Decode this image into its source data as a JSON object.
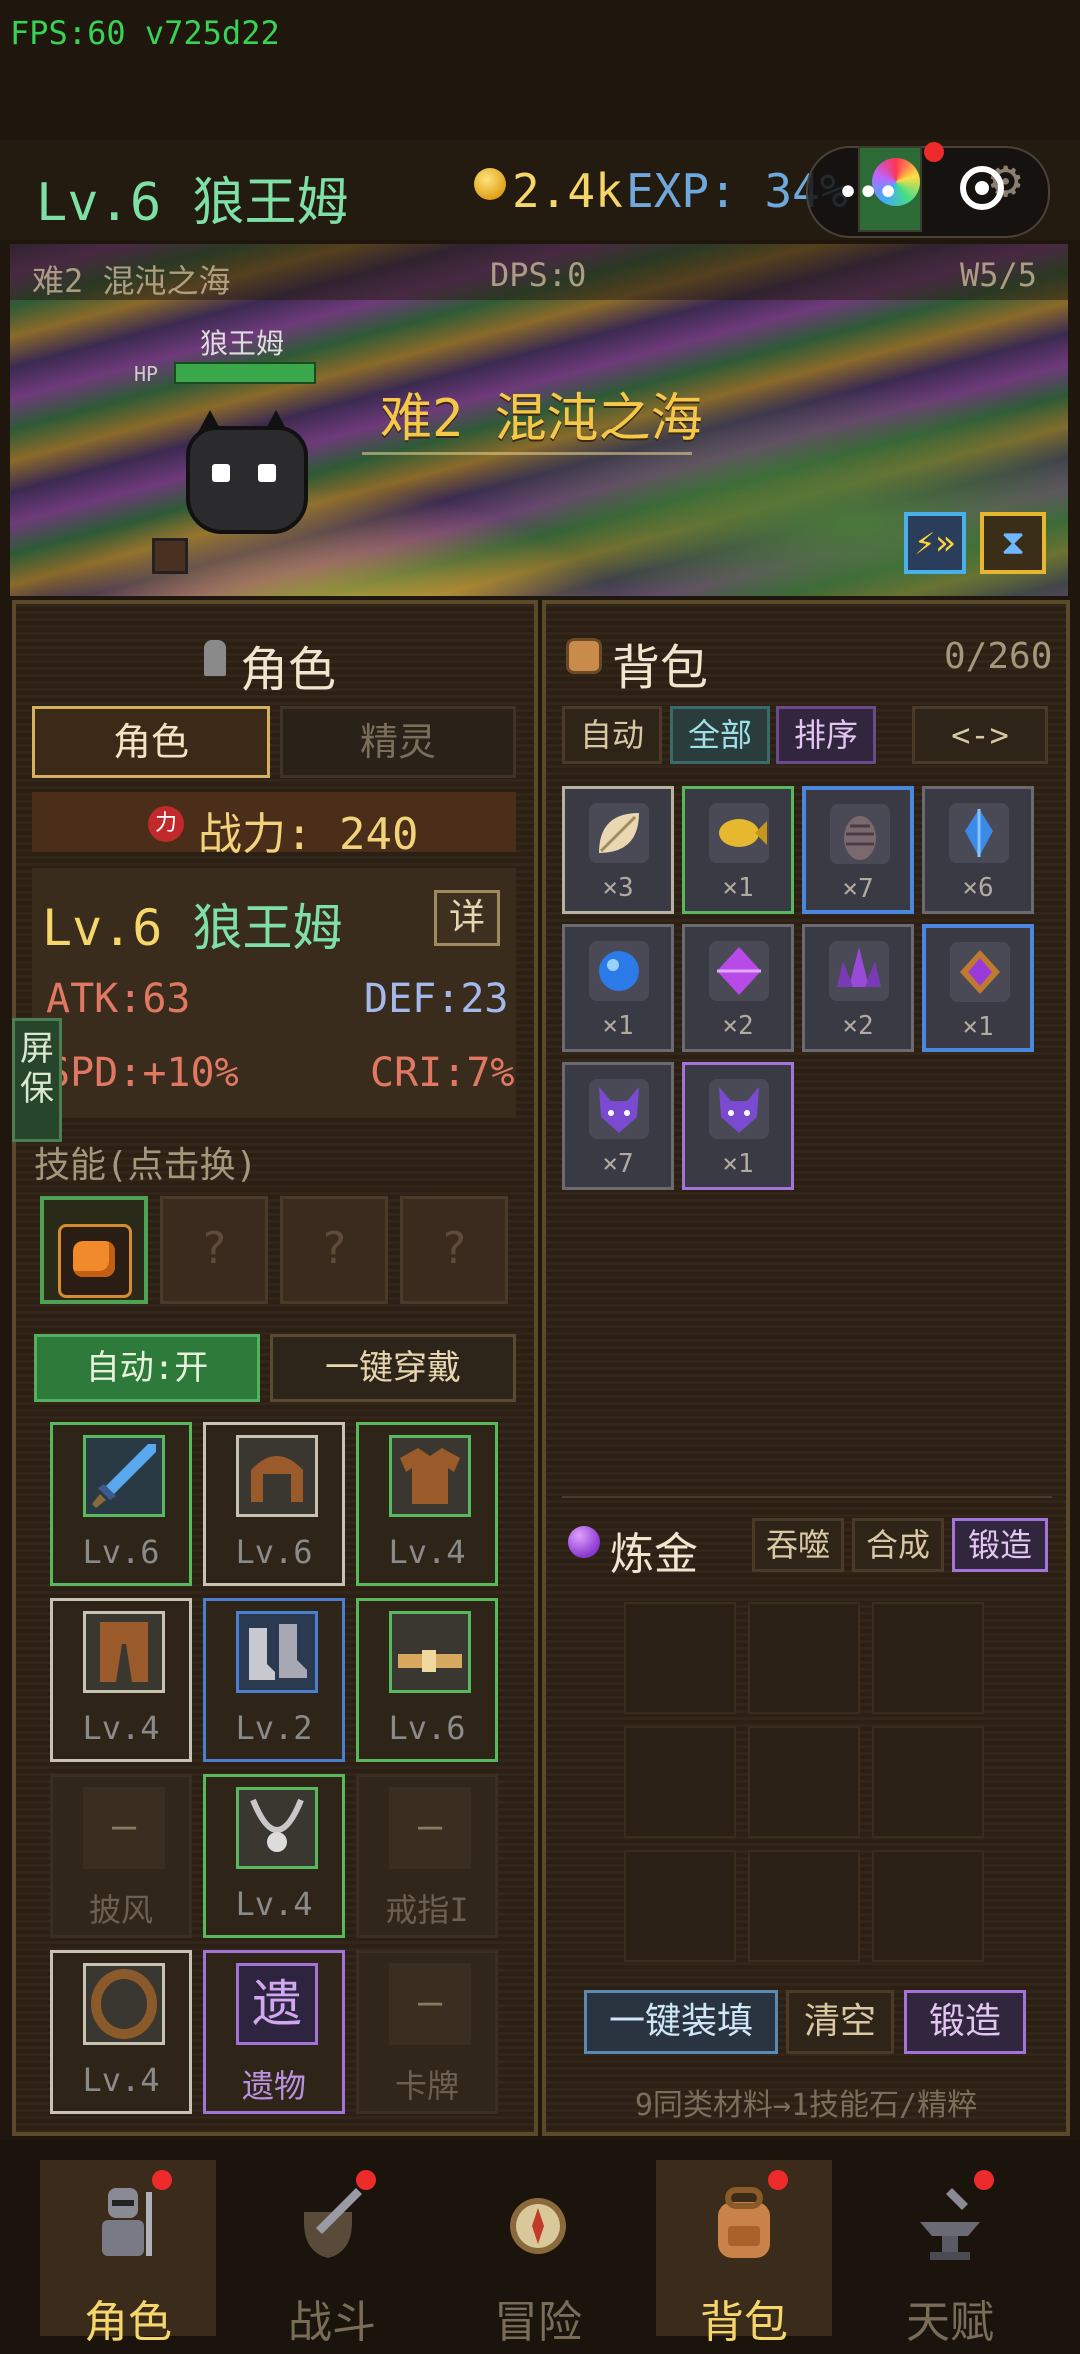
{
  "status": {
    "fps": "FPS:60 v725d22"
  },
  "header": {
    "level": "Lv.6",
    "name": "狼王姆",
    "gold": "2.4k",
    "exp": "EXP: 34%",
    "menu_dots": "•••"
  },
  "battle": {
    "difficulty": "难2",
    "zone": "混沌之海",
    "dps": "DPS:0",
    "wave": "W5/5",
    "title_diff": "难2",
    "title_zone": "混沌之海",
    "enemy_name": "狼王姆",
    "hp_label": "HP",
    "speed_icon": "⚡»",
    "hourglass_icon": "⧗"
  },
  "character": {
    "panel_title": "角色",
    "tabs": [
      "角色",
      "精灵"
    ],
    "power_icon_text": "力",
    "power_label": "战力: 240",
    "level": "Lv.6",
    "name": "狼王姆",
    "detail": "详",
    "stats": {
      "atk": "ATK:63",
      "def": "DEF:23",
      "spd": "SPD:+10%",
      "cri": "CRI:7%"
    },
    "side_tab": "屏保",
    "skills_label": "技能(点击换)",
    "empty_skill": "?",
    "auto_label": "自动:开",
    "equip_all": "一键穿戴",
    "equipment": [
      {
        "label": "Lv.6",
        "icon": "sword-icon"
      },
      {
        "label": "Lv.6",
        "icon": "helmet-icon"
      },
      {
        "label": "Lv.4",
        "icon": "armor-icon"
      },
      {
        "label": "Lv.4",
        "icon": "pants-icon"
      },
      {
        "label": "Lv.2",
        "icon": "boots-icon"
      },
      {
        "label": "Lv.6",
        "icon": "belt-icon"
      },
      {
        "label": "披风",
        "icon": "empty-slot-icon"
      },
      {
        "label": "Lv.4",
        "icon": "necklace-icon"
      },
      {
        "label": "戒指I",
        "icon": "empty-slot-icon"
      },
      {
        "label": "Lv.4",
        "icon": "ring-icon"
      },
      {
        "label": "遗物",
        "icon": "relic-icon"
      },
      {
        "label": "卡牌",
        "icon": "empty-slot-icon"
      }
    ],
    "relic_glyph": "遗",
    "empty_glyph": "–"
  },
  "backpack": {
    "title": "背包",
    "count": "0/260",
    "filters": [
      "自动",
      "全部",
      "排序"
    ],
    "nav_prev": "<",
    "nav_sep": "-",
    "nav_next": ">",
    "items": [
      {
        "count": "×3",
        "icon": "leaf-icon",
        "color": "#e8d7b0"
      },
      {
        "count": "×1",
        "icon": "golden-fish-icon",
        "color": "#e6b830"
      },
      {
        "count": "×7",
        "icon": "pinecone-icon",
        "color": "#7a6a70"
      },
      {
        "count": "×6",
        "icon": "blue-crystal-icon",
        "color": "#3a8ae8"
      },
      {
        "count": "×1",
        "icon": "blue-orb-icon",
        "color": "#2a7ae8"
      },
      {
        "count": "×2",
        "icon": "purple-gem-icon",
        "color": "#b84ae8"
      },
      {
        "count": "×2",
        "icon": "purple-crystal-icon",
        "color": "#9a4ad8"
      },
      {
        "count": "×1",
        "icon": "amethyst-icon",
        "color": "#c07a30"
      },
      {
        "count": "×7",
        "icon": "wolf-head-icon",
        "color": "#7a4ad0"
      },
      {
        "count": "×1",
        "icon": "wolf-head-icon",
        "color": "#7a4ad0"
      }
    ]
  },
  "alchemy": {
    "title": "炼金",
    "modes": [
      "吞噬",
      "合成",
      "锻造"
    ],
    "fill_all": "一键装填",
    "clear": "清空",
    "forge": "锻造",
    "hint": "9同类材料→1技能石/精粹"
  },
  "nav": [
    {
      "label": "角色",
      "icon": "knight-icon"
    },
    {
      "label": "战斗",
      "icon": "sword-shield-icon"
    },
    {
      "label": "冒险",
      "icon": "compass-icon"
    },
    {
      "label": "背包",
      "icon": "backpack-icon"
    },
    {
      "label": "天赋",
      "icon": "anvil-icon"
    }
  ]
}
